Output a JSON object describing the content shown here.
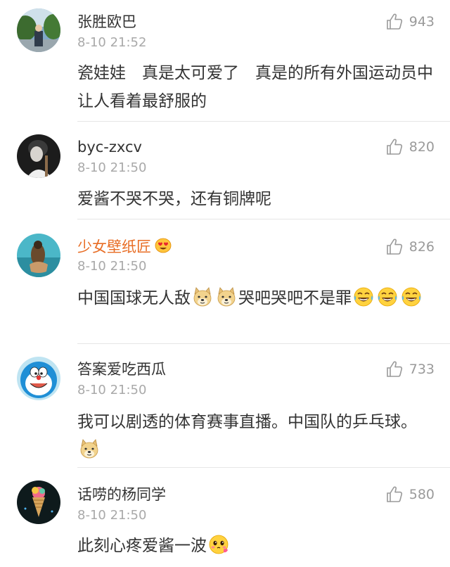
{
  "comments": [
    {
      "username": "张胜欧巴",
      "time": "8-10 21:52",
      "likes": "943",
      "text": [
        "瓷娃娃　真是太可爱了　真是的所有外国运动员中让人看着最舒服的"
      ]
    },
    {
      "username": "byc-zxcv",
      "time": "8-10 21:50",
      "likes": "820",
      "text": [
        "爱酱不哭不哭，还有铜牌呢"
      ]
    },
    {
      "username": "少女壁纸匠",
      "time": "8-10 21:50",
      "likes": "826",
      "text": [
        "中国国球无人敌",
        "哭吧哭吧不是罪"
      ]
    },
    {
      "username": "答案爱吃西瓜",
      "time": "8-10 21:50",
      "likes": "733",
      "text": [
        "我可以剧透的体育赛事直播。中国队的乒乓球。"
      ]
    },
    {
      "username": "话唠的杨同学",
      "time": "8-10 21:50",
      "likes": "580",
      "text": [
        "此刻心疼爱酱一波"
      ]
    }
  ]
}
